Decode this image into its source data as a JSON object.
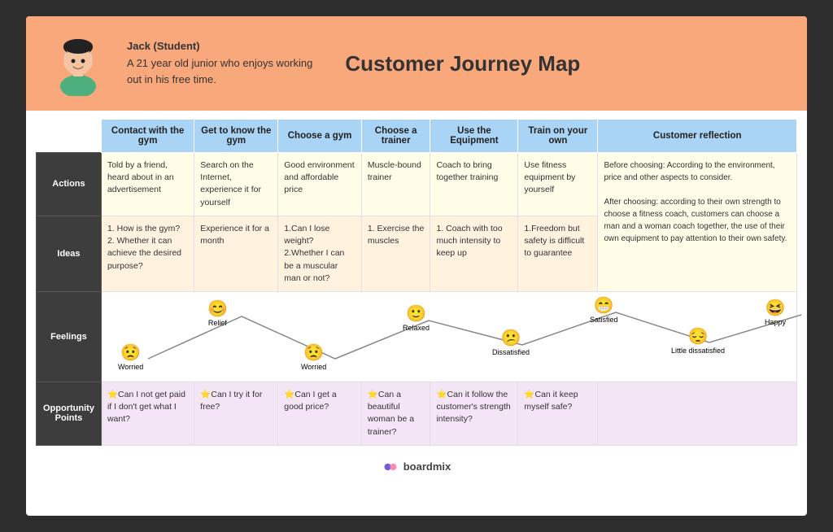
{
  "header": {
    "persona_name": "Jack (Student)",
    "persona_desc": "A 21 year old junior who enjoys working\nout in his free time.",
    "map_title": "Customer Journey Map"
  },
  "columns": [
    "Contact with the gym",
    "Get to know the gym",
    "Choose a gym",
    "Choose a trainer",
    "Use the Equipment",
    "Train on your own",
    "Customer reflection"
  ],
  "rows": {
    "actions": {
      "label": "Actions",
      "cells": [
        "Told by a friend, heard about in an advertisement",
        "Search on the Internet, experience it for yourself",
        "Good environment and affordable price",
        "Muscle-bound trainer",
        "Coach to bring together training",
        "Use fitness equipment by yourself",
        "Before choosing: According to the environment, price and other aspects to consider.\n\nAfter choosing: according to their own strength to choose a fitness coach, customers can choose a man and a woman coach together, the use of their own equipment to pay attention to their own safety."
      ]
    },
    "ideas": {
      "label": "Ideas",
      "cells": [
        "1. How is the gym?\n2. Whether it can achieve the desired purpose?",
        "Experience it for a month",
        "1.Can I lose weight?\n2.Whether I can be a muscular man or not?",
        "1. Exercise the muscles",
        "1. Coach with too much intensity to keep up",
        "1.Freedom but safety is difficult to guarantee",
        ""
      ]
    },
    "feelings": {
      "label": "Feelings",
      "items": [
        {
          "emoji": "😟",
          "label": "Worried",
          "level": 4
        },
        {
          "emoji": "😊",
          "label": "Relief",
          "level": 2
        },
        {
          "emoji": "😟",
          "label": "Worried",
          "level": 4
        },
        {
          "emoji": "🙂",
          "label": "Relaxed",
          "level": 2
        },
        {
          "emoji": "😕",
          "label": "Dissatisfied",
          "level": 3
        },
        {
          "emoji": "😁",
          "label": "Satisfied",
          "level": 1
        },
        {
          "emoji": "😔",
          "label": "Little dissatisfied",
          "level": 3
        },
        {
          "emoji": "😆",
          "label": "Happy",
          "level": 1
        }
      ]
    },
    "opportunity": {
      "label": "Opportunity Points",
      "cells": [
        "⭐Can I not get paid if I don't get what I want?",
        "⭐Can I try it for free?",
        "⭐Can I get a good price?",
        "⭐Can a beautiful woman be a trainer?",
        "⭐Can it follow the customer's strength intensity?",
        "⭐Can it keep myself safe?",
        ""
      ]
    }
  },
  "footer": {
    "brand": "boardmix"
  }
}
